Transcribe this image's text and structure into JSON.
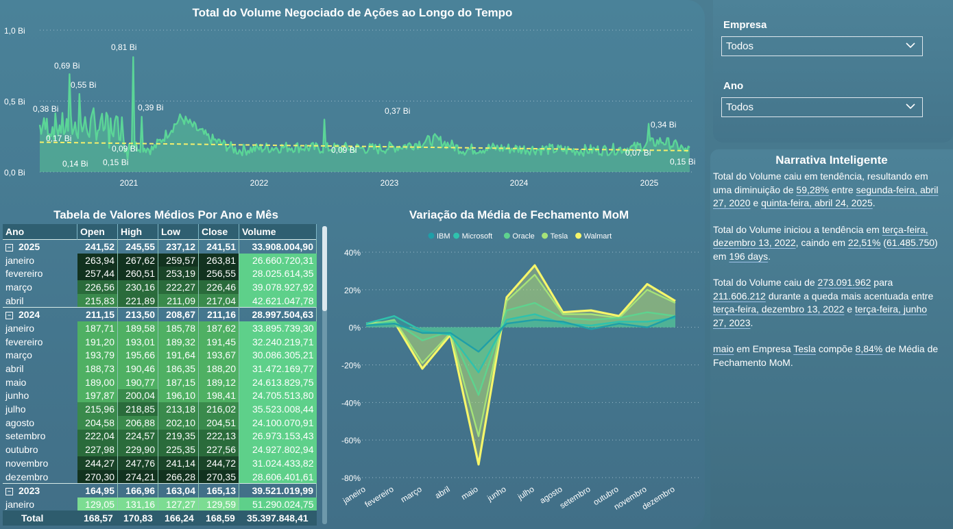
{
  "area_chart": {
    "title": "Total do Volume Negociado de Ações ao Longo do Tempo",
    "y_ticks": [
      "1,0 Bi",
      "0,5 Bi",
      "0,0 Bi"
    ],
    "x_ticks": [
      "2021",
      "2022",
      "2023",
      "2024",
      "2025"
    ],
    "labels": [
      "0,81 Bi",
      "0,69 Bi",
      "0,55 Bi",
      "0,38 Bi",
      "0,39 Bi",
      "0,17 Bi",
      "0,14 Bi",
      "0,09 Bi",
      "0,15 Bi",
      "0,37 Bi",
      "0,09 Bi",
      "0,34 Bi",
      "0,07 Bi",
      "0,15 Bi"
    ],
    "series_color": "#5bd597",
    "trend_color": "#f6f06c"
  },
  "slicers": {
    "empresa": {
      "label": "Empresa",
      "value": "Todos"
    },
    "ano": {
      "label": "Ano",
      "value": "Todos"
    }
  },
  "narrative": {
    "title": "Narrativa Inteligente",
    "p1": [
      "Total do Volume caiu em tendência, resultando em uma diminuição de ",
      "59,28%",
      " entre ",
      "segunda-feira, abril 27, 2020",
      " e ",
      "quinta-feira, abril 24, 2025",
      "."
    ],
    "p2": [
      "Total do Volume iniciou a tendência em ",
      "terça-feira, dezembro 13, 2022",
      ", caindo em ",
      "22,51%",
      " (",
      "61.485.750",
      ") em ",
      "196 days",
      "."
    ],
    "p3": [
      "Total do Volume caiu de ",
      "273.091.962",
      " para ",
      "211.606.212",
      " durante a queda mais acentuada entre ",
      "terça-feira, dezembro 13, 2022",
      " e ",
      "terça-feira, junho 27, 2023",
      "."
    ],
    "p4": [
      "maio",
      " em Empresa ",
      "Tesla",
      " compõe ",
      "8,84%",
      " de Média de Fechamento MoM."
    ]
  },
  "table": {
    "title": "Tabela de Valores Médios Por Ano e Mês",
    "headers": [
      "Ano",
      "Open",
      "High",
      "Low",
      "Close",
      "Volume"
    ],
    "rows": [
      {
        "type": "year",
        "label": "2025",
        "v": [
          "241,52",
          "245,55",
          "237,12",
          "241,51",
          "33.908.004,90"
        ]
      },
      {
        "type": "month",
        "label": "janeiro",
        "v": [
          "263,94",
          "267,62",
          "259,57",
          "263,81",
          "26.660.720,31"
        ]
      },
      {
        "type": "month",
        "label": "fevereiro",
        "v": [
          "257,44",
          "260,51",
          "253,19",
          "256,55",
          "28.025.614,35"
        ]
      },
      {
        "type": "month",
        "label": "março",
        "v": [
          "226,56",
          "230,16",
          "222,27",
          "226,46",
          "39.078.927,92"
        ]
      },
      {
        "type": "month",
        "label": "abril",
        "v": [
          "215,83",
          "221,89",
          "211,09",
          "217,04",
          "42.621.047,78"
        ]
      },
      {
        "type": "year",
        "label": "2024",
        "v": [
          "211,15",
          "213,50",
          "208,67",
          "211,16",
          "28.997.504,63"
        ]
      },
      {
        "type": "month",
        "label": "janeiro",
        "v": [
          "187,71",
          "189,58",
          "185,78",
          "187,62",
          "33.895.739,30"
        ]
      },
      {
        "type": "month",
        "label": "fevereiro",
        "v": [
          "191,20",
          "193,01",
          "189,32",
          "191,45",
          "32.240.219,71"
        ]
      },
      {
        "type": "month",
        "label": "março",
        "v": [
          "193,79",
          "195,66",
          "191,64",
          "193,67",
          "30.086.305,21"
        ]
      },
      {
        "type": "month",
        "label": "abril",
        "v": [
          "188,73",
          "190,46",
          "186,35",
          "188,20",
          "31.472.169,77"
        ]
      },
      {
        "type": "month",
        "label": "maio",
        "v": [
          "189,00",
          "190,77",
          "187,15",
          "189,12",
          "24.613.829,75"
        ]
      },
      {
        "type": "month",
        "label": "junho",
        "v": [
          "197,87",
          "200,04",
          "196,10",
          "198,41",
          "24.705.513,80"
        ]
      },
      {
        "type": "month",
        "label": "julho",
        "v": [
          "215,96",
          "218,85",
          "213,18",
          "216,02",
          "35.523.008,44"
        ]
      },
      {
        "type": "month",
        "label": "agosto",
        "v": [
          "204,58",
          "206,88",
          "202,10",
          "204,51",
          "24.100.070,91"
        ]
      },
      {
        "type": "month",
        "label": "setembro",
        "v": [
          "222,04",
          "224,57",
          "219,35",
          "222,13",
          "26.973.153,43"
        ]
      },
      {
        "type": "month",
        "label": "outubro",
        "v": [
          "227,98",
          "229,90",
          "225,35",
          "227,56",
          "24.927.802,94"
        ]
      },
      {
        "type": "month",
        "label": "novembro",
        "v": [
          "244,27",
          "247,76",
          "241,14",
          "244,72",
          "31.024.433,82"
        ]
      },
      {
        "type": "month",
        "label": "dezembro",
        "v": [
          "270,30",
          "274,21",
          "266,28",
          "270,35",
          "28.606.401,61"
        ]
      },
      {
        "type": "year",
        "label": "2023",
        "v": [
          "164,95",
          "166,96",
          "163,04",
          "165,13",
          "39.521.019,99"
        ]
      },
      {
        "type": "month",
        "label": "janeiro",
        "v": [
          "129,05",
          "131,16",
          "127,27",
          "129,59",
          "51.290.024,75"
        ]
      }
    ],
    "total": {
      "label": "Total",
      "v": [
        "168,57",
        "170,83",
        "166,24",
        "168,59",
        "35.397.848,41"
      ]
    }
  },
  "line_chart": {
    "title": "Variação da Média de Fechamento MoM",
    "y_ticks": [
      "40%",
      "20%",
      "0%",
      "-20%",
      "-40%",
      "-60%",
      "-80%"
    ],
    "months": [
      "janeiro",
      "fevereiro",
      "março",
      "abril",
      "maio",
      "junho",
      "julho",
      "agosto",
      "setembro",
      "outubro",
      "novembro",
      "dezembro"
    ],
    "legend": [
      {
        "name": "IBM",
        "color": "#1f9fa8"
      },
      {
        "name": "Microsoft",
        "color": "#2fc2ad"
      },
      {
        "name": "Oracle",
        "color": "#5ed38e"
      },
      {
        "name": "Tesla",
        "color": "#a6e378"
      },
      {
        "name": "Walmart",
        "color": "#f6f66a"
      }
    ]
  },
  "chart_data": [
    {
      "type": "area",
      "title": "Total do Volume Negociado de Ações ao Longo do Tempo",
      "ylim": [
        0,
        1.0
      ],
      "x": [
        "2020-04",
        "2020-06",
        "2020-08",
        "2020-10",
        "2020-12",
        "2021-01",
        "2021-03",
        "2021-06",
        "2021-09",
        "2021-12",
        "2022-03",
        "2022-06",
        "2022-09",
        "2022-12",
        "2023-03",
        "2023-06",
        "2023-09",
        "2023-12",
        "2024-03",
        "2024-06",
        "2024-09",
        "2024-12",
        "2025-02",
        "2025-04"
      ],
      "y": [
        0.38,
        0.69,
        0.55,
        0.3,
        0.17,
        0.81,
        0.39,
        0.15,
        0.2,
        0.22,
        0.19,
        0.2,
        0.18,
        0.25,
        0.37,
        0.16,
        0.2,
        0.18,
        0.17,
        0.15,
        0.16,
        0.2,
        0.34,
        0.15
      ],
      "trend": {
        "start": 0.21,
        "end": 0.15
      }
    },
    {
      "type": "line",
      "title": "Variação da Média de Fechamento MoM",
      "categories": [
        "janeiro",
        "fevereiro",
        "março",
        "abril",
        "maio",
        "junho",
        "julho",
        "agosto",
        "setembro",
        "outubro",
        "novembro",
        "dezembro"
      ],
      "ylim": [
        -80,
        40
      ],
      "series": [
        {
          "name": "IBM",
          "values": [
            1,
            2,
            -3,
            -3,
            -13,
            2,
            4,
            3,
            -1,
            2,
            0,
            6
          ]
        },
        {
          "name": "Microsoft",
          "values": [
            2,
            6,
            -2,
            -4,
            -24,
            4,
            7,
            2,
            1,
            3,
            3,
            5
          ]
        },
        {
          "name": "Oracle",
          "values": [
            1,
            3,
            -7,
            -2,
            -36,
            9,
            13,
            5,
            4,
            5,
            8,
            6
          ]
        },
        {
          "name": "Tesla",
          "values": [
            1,
            4,
            -19,
            -3,
            -58,
            14,
            28,
            7,
            7,
            5,
            20,
            13
          ]
        },
        {
          "name": "Walmart",
          "values": [
            2,
            3,
            -22,
            -4,
            -73,
            16,
            33,
            8,
            9,
            6,
            23,
            14
          ]
        }
      ]
    }
  ]
}
